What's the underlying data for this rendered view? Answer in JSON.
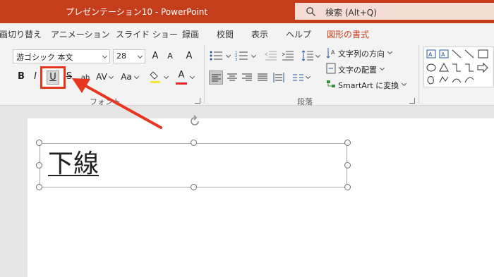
{
  "window": {
    "title": "プレゼンテーション10  -  PowerPoint",
    "search_label": "検索 (Alt+Q)"
  },
  "tabs": [
    "画切り替え",
    "アニメーション",
    "スライド ショー",
    "録画",
    "校閲",
    "表示",
    "ヘルプ",
    "図形の書式"
  ],
  "font_group": {
    "font_name": "游ゴシック 本文",
    "font_size": "28",
    "grow_label": "A",
    "shrink_label": "A",
    "clear_label": "A",
    "bold": "B",
    "italic": "I",
    "underline": "U",
    "strike": "S",
    "shadow": "ab",
    "spacing": "AV",
    "case": "Aa",
    "color_a": "A",
    "label": "フォント"
  },
  "paragraph_group": {
    "label": "段落",
    "text_direction": "文字列の方向",
    "align_text": "文字の配置",
    "smartart": "SmartArt に変換"
  },
  "slide": {
    "text": "下線"
  },
  "colors": {
    "titlebar": "#c43e1c",
    "highlight_box": "#e8351f",
    "arrow": "#e8351f"
  }
}
